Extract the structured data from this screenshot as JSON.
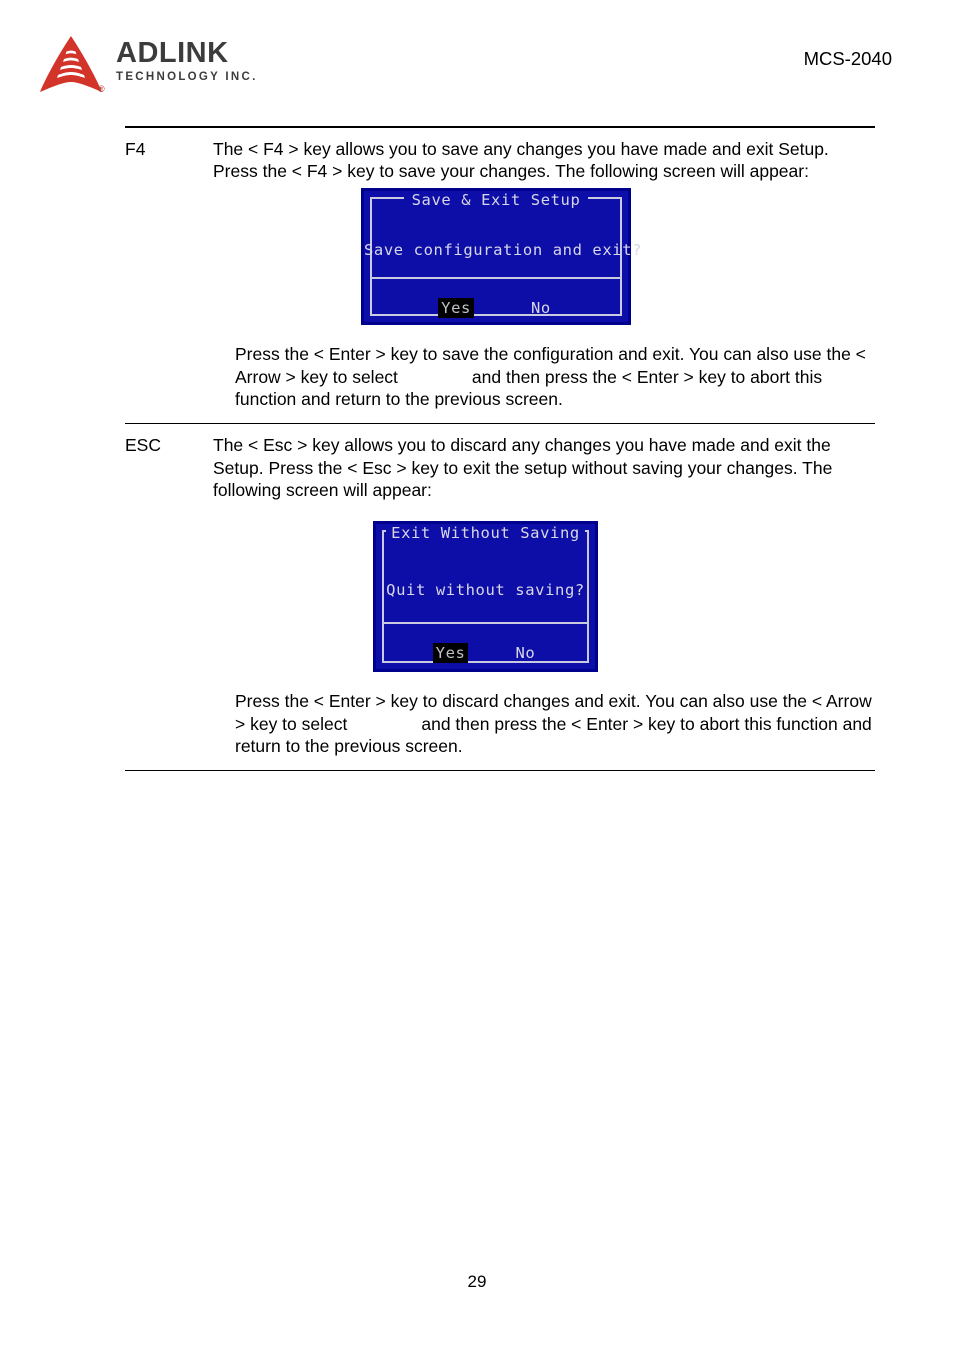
{
  "header": {
    "logo_name": "ADLINK",
    "logo_sub": "TECHNOLOGY INC.",
    "logo_registered": "®",
    "model": "MCS-2040"
  },
  "sections": [
    {
      "key": "F4",
      "body": "The < F4 > key allows you to save any changes you have made and exit Setup. Press the < F4 > key to save your changes. The following screen will appear:",
      "dialog": {
        "title": "Save & Exit Setup",
        "message": "Save configuration and exit?",
        "yes_label": "Yes",
        "no_label": "No",
        "selected": "Yes"
      },
      "footnote_before_gap": "Press the < Enter > key to save the configuration and exit. You can also use the < Arrow > key to select",
      "footnote_after_gap": "and then press the < Enter > key to abort this function and return to the previous screen."
    },
    {
      "key": "ESC",
      "body": "The < Esc > key allows you to discard any changes you have made and exit the Setup. Press the < Esc > key to exit the setup without saving your changes. The following screen will appear:",
      "dialog": {
        "title": "Exit Without Saving",
        "message": "Quit without saving?",
        "yes_label": "Yes",
        "no_label": "No",
        "selected": "Yes"
      },
      "footnote_before_gap": "Press the < Enter > key to discard changes and exit. You can also use the < Arrow > key to select",
      "footnote_after_gap": "and then press the < Enter > key to abort this function and return to the previous screen."
    }
  ],
  "footer": {
    "page_number": "29"
  },
  "colors": {
    "logo_red": "#d3342a",
    "logo_gray": "#3c3c3c",
    "bios_background": "#0d0da8",
    "bios_border_outer": "#00008f",
    "bios_border_inner": "#c9c9e0",
    "bios_text": "#d8d8e8",
    "bios_selected_background": "#000000"
  }
}
